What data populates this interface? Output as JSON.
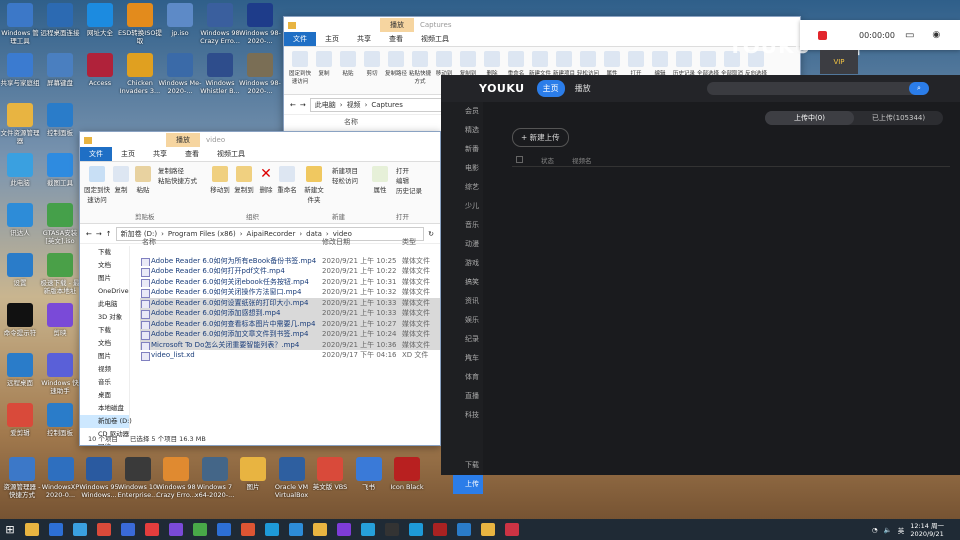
{
  "desktop_icons": [
    {
      "label": "Windows 管理工具",
      "color": "#3c78c8"
    },
    {
      "label": "远程桌面连接",
      "color": "#2c6ab2"
    },
    {
      "label": "网址大全",
      "color": "#1c8be0"
    },
    {
      "label": "ESD转换ISO提取",
      "color": "#e38b1c"
    },
    {
      "label": "jp.iso",
      "color": "#5d8ac7"
    },
    {
      "label": "Windows 98 Crazy Erro...",
      "color": "#3a5f9e"
    },
    {
      "label": "Windows 98-2020-...",
      "color": "#1e3c8a"
    },
    {
      "label": "共享与家庭组",
      "color": "#3b7bd0"
    },
    {
      "label": "屏幕键盘",
      "color": "#4a7fc0"
    },
    {
      "label": "Access",
      "color": "#b0223a"
    },
    {
      "label": "Chicken Invaders 3...",
      "color": "#e0a020"
    },
    {
      "label": "Windows Me-2020-...",
      "color": "#3a6aa8"
    },
    {
      "label": "Windows Whistler B...",
      "color": "#2e4d8c"
    },
    {
      "label": "Windows 98-2020-...",
      "color": "#7a6e55"
    },
    {
      "label": "文件资源管理器",
      "color": "#e8b441"
    },
    {
      "label": "控制面板",
      "color": "#2a7cc9"
    },
    {
      "label": "此电脑",
      "color": "#3aa0e0"
    },
    {
      "label": "截图工具",
      "color": "#2e8be0"
    },
    {
      "label": "讯达人",
      "color": "#2d8cd8"
    },
    {
      "label": "GTASA安装 [英文].iso",
      "color": "#45a04a"
    },
    {
      "label": "设置",
      "color": "#2a7cc9"
    },
    {
      "label": "极速下载 - 最新版本地址",
      "color": "#4aa048"
    },
    {
      "label": "命令提示符",
      "color": "#111111"
    },
    {
      "label": "剪映",
      "color": "#7a4ad8"
    },
    {
      "label": "远程桌面",
      "color": "#2a7cc9"
    },
    {
      "label": "Windows 快速助手",
      "color": "#5a60d8"
    },
    {
      "label": "爱剪辑",
      "color": "#d94a3a"
    },
    {
      "label": "控制面板",
      "color": "#2a7cc9"
    }
  ],
  "bottom_icons": [
    {
      "label": "资源管理器 - 快捷方式",
      "color": "#3c78c8"
    },
    {
      "label": "WindowsXP 2020-0...",
      "color": "#2e6fbf"
    },
    {
      "label": "Windows 95 Windows...",
      "color": "#2a5aa0"
    },
    {
      "label": "Windows 10 Enterprise...",
      "color": "#3a3a3a"
    },
    {
      "label": "Windows 98 Crazy Erro...",
      "color": "#e08a30"
    },
    {
      "label": "Windows 7 x64-2020-...",
      "color": "#446688"
    },
    {
      "label": "图片",
      "color": "#e8b441"
    },
    {
      "label": "Oracle VM VirtualBox",
      "color": "#2e5fa0"
    },
    {
      "label": "英文版 VBS",
      "color": "#d94a3a"
    },
    {
      "label": "飞书",
      "color": "#3a7ad8"
    },
    {
      "label": "Icon Black",
      "color": "#b82020"
    }
  ],
  "captures_window": {
    "title": "Captures",
    "context_tab": "播放",
    "tabs": [
      "文件",
      "主页",
      "共享",
      "查看",
      "视频工具"
    ],
    "breadcrumb": [
      "此电脑",
      "视频",
      "Captures"
    ],
    "col_name": "名称",
    "ribbon": [
      "固定到快速访问",
      "复制",
      "粘贴",
      "剪切",
      "复制路径",
      "粘贴快捷方式",
      "移动到",
      "复制到",
      "删除",
      "重命名",
      "新建文件夹",
      "新建项目",
      "轻松访问",
      "属性",
      "打开",
      "编辑",
      "历史记录",
      "全部选择",
      "全部取消",
      "反向选择"
    ]
  },
  "video_window": {
    "title": "video",
    "context_tab": "播放",
    "tabs": [
      "文件",
      "主页",
      "共享",
      "查看",
      "视频工具"
    ],
    "ribbon": {
      "pin": "固定到快速访问",
      "copy": "复制",
      "paste": "粘贴",
      "copy_path": "复制路径",
      "paste_shortcut": "粘贴快捷方式",
      "cut": "剪切",
      "move_to": "移动到",
      "copy_to": "复制到",
      "delete": "删除",
      "rename": "重命名",
      "new_folder": "新建文件夹",
      "new_item": "新建项目",
      "easy_access": "轻松访问",
      "properties": "属性",
      "open": "打开",
      "edit": "编辑",
      "history": "历史记录",
      "group_clipboard": "剪贴板",
      "group_organize": "组织",
      "group_new": "新建",
      "group_open": "打开"
    },
    "breadcrumb": [
      "新加卷 (D:)",
      "Program Files (x86)",
      "AipaiRecorder",
      "data",
      "video"
    ],
    "columns": {
      "name": "名称",
      "date": "修改日期",
      "type": "类型"
    },
    "nav": [
      "下载",
      "文档",
      "图片",
      "OneDrive",
      "此电脑",
      "3D 对象",
      "下载",
      "文档",
      "图片",
      "视频",
      "音乐",
      "桌面",
      "本地磁盘",
      "新加卷 (D:)",
      "CD 驱动器",
      "网络"
    ],
    "files": [
      {
        "name": "Adobe Reader 6.0如何为所有eBook备份书签.mp4",
        "date": "2020/9/21 上午 10:25",
        "type": "媒体文件",
        "selected": false
      },
      {
        "name": "Adobe Reader 6.0如何打开pdf文件.mp4",
        "date": "2020/9/21 上午 10:22",
        "type": "媒体文件",
        "selected": false
      },
      {
        "name": "Adobe Reader 6.0如何关闭ebook任务按钮.mp4",
        "date": "2020/9/21 上午 10:31",
        "type": "媒体文件",
        "selected": false
      },
      {
        "name": "Adobe Reader 6.0如何关闭操作方法窗口.mp4",
        "date": "2020/9/21 上午 10:32",
        "type": "媒体文件",
        "selected": false
      },
      {
        "name": "Adobe Reader 6.0如何设置纸张的打印大小.mp4",
        "date": "2020/9/21 上午 10:33",
        "type": "媒体文件",
        "selected": true
      },
      {
        "name": "Adobe Reader 6.0如何添加感想到.mp4",
        "date": "2020/9/21 上午 10:33",
        "type": "媒体文件",
        "selected": true
      },
      {
        "name": "Adobe Reader 6.0如何查看标本图片中需要几.mp4",
        "date": "2020/9/21 上午 10:27",
        "type": "媒体文件",
        "selected": true
      },
      {
        "name": "Adobe Reader 6.0如何添加文章文件到书签.mp4",
        "date": "2020/9/21 上午 10:24",
        "type": "媒体文件",
        "selected": true
      },
      {
        "name": "Microsoft To Do怎么关闭重要智能列表？.mp4",
        "date": "2020/9/21 上午 10:36",
        "type": "媒体文件",
        "selected": true
      },
      {
        "name": "video_list.xd",
        "date": "2020/9/17 下午 04:16",
        "type": "XD 文件",
        "selected": false
      }
    ],
    "status": {
      "count": "10 个项目",
      "selection": "已选择 5 个项目  16.3 MB"
    }
  },
  "youku": {
    "logo": "YOUKU",
    "home": "主页",
    "play": "播放",
    "search_icon": "search-icon",
    "sidebar": [
      "会员",
      "精选",
      "新番",
      "电影",
      "综艺",
      "少儿",
      "音乐",
      "动漫",
      "游戏",
      "搞笑",
      "资讯",
      "娱乐",
      "纪录片",
      "汽车",
      "体育",
      "直播",
      "科技"
    ],
    "sidebar_bottom": [
      "下载",
      "上传"
    ],
    "segment": {
      "uploading": "上传中(0)",
      "uploaded": "已上传(105344)"
    },
    "new_upload": "+ 新建上传",
    "table_head": {
      "status": "状态",
      "name": "视频名"
    }
  },
  "recorder": {
    "time": "00:00:00"
  },
  "watermark": "YOUKU 优酷",
  "vip": "VIP",
  "taskbar": {
    "apps": [
      "#e8b441",
      "#2d6fd4",
      "#3aa0e0",
      "#d94a3a",
      "#3a6ad8",
      "#e33d3d",
      "#7a4ad8",
      "#48a848",
      "#2d6fd4",
      "#dd5533",
      "#1e9ad8",
      "#2d8cd8",
      "#e8b441",
      "#7e3cd8",
      "#26a0da",
      "#333333",
      "#1e9ad8",
      "#aa2222",
      "#2a7cc9",
      "#e8b441",
      "#cc3344"
    ],
    "time": "12:14 周一",
    "date": "2020/9/21",
    "lang": "英"
  }
}
